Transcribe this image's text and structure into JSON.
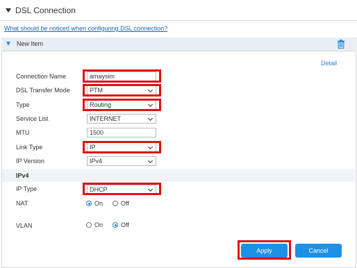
{
  "section": {
    "title": "DSL Connection"
  },
  "help_link": "What should be noticed when configuring DSL connection?",
  "panel": {
    "title": "New Item",
    "detail_link": "Detail"
  },
  "form": {
    "connection_name": {
      "label": "Connection Name",
      "value": "amaysim"
    },
    "dsl_transfer_mode": {
      "label": "DSL Transfer Mode",
      "value": "PTM"
    },
    "type": {
      "label": "Type",
      "value": "Routing"
    },
    "service_list": {
      "label": "Service List",
      "value": "INTERNET"
    },
    "mtu": {
      "label": "MTU",
      "value": "1500"
    },
    "link_type": {
      "label": "Link Type",
      "value": "IP"
    },
    "ip_version": {
      "label": "IP Version",
      "value": "IPv4"
    },
    "ipv4_heading": "IPv4",
    "ip_type": {
      "label": "IP Type",
      "value": "DHCP"
    },
    "nat": {
      "label": "NAT",
      "on": "On",
      "off": "Off",
      "selected": "On"
    },
    "vlan": {
      "label": "VLAN",
      "on": "On",
      "off": "Off",
      "selected": "Off"
    }
  },
  "buttons": {
    "apply": "Apply",
    "cancel": "Cancel"
  },
  "colors": {
    "accent": "#1e90e6",
    "highlight": "#e01010",
    "link": "#1a64b8"
  },
  "icons": {
    "trash": "trash-icon"
  }
}
